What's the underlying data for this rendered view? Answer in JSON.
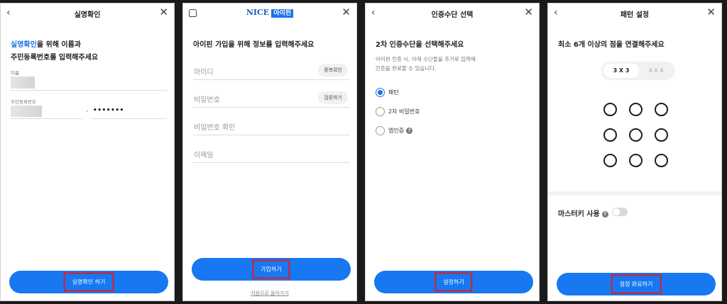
{
  "panel1": {
    "title": "실명확인",
    "back_icon": "chevron-left-icon",
    "close_icon": "close-icon",
    "heading_highlight": "실명확인",
    "heading_line1_rest": "을 위해 이름과",
    "heading_line2": "주민등록번호를 입력해주세요",
    "name_label": "이름",
    "rrn_label": "주민등록번호",
    "rrn_separator": "-",
    "rrn_back_masked": "•••••••",
    "submit_label": "실명확인 하기"
  },
  "panel2": {
    "brand_nice": "NICE",
    "brand_ipin": "아이핀",
    "home_icon": "home-icon",
    "close_icon": "close-icon",
    "heading": "아이핀 가입을 위해 정보를 입력해주세요",
    "fields": [
      {
        "placeholder": "아이디",
        "action": "중복확인"
      },
      {
        "placeholder": "비밀번호",
        "action": "검증하기"
      },
      {
        "placeholder": "비밀번호 확인",
        "action": ""
      },
      {
        "placeholder": "이메일",
        "action": ""
      }
    ],
    "submit_label": "가입하기",
    "back_link": "처음으로 돌아가기"
  },
  "panel3": {
    "title": "인증수단 선택",
    "back_icon": "chevron-left-icon",
    "close_icon": "close-icon",
    "heading": "2차 인증수단을 선택해주세요",
    "desc_line1": "아이핀 인증 시, 아래 수단들을 추가로 입력해",
    "desc_line2": "인증을 완료할 수 있습니다.",
    "options": [
      {
        "label": "패턴",
        "selected": true
      },
      {
        "label": "2차 비밀번호",
        "selected": false
      },
      {
        "label": "앱인증",
        "selected": false
      }
    ],
    "submit_label": "설정하기"
  },
  "panel4": {
    "title": "패턴 설정",
    "back_icon": "chevron-left-icon",
    "close_icon": "close-icon",
    "heading": "최소 6개 이상의 점을 연결해주세요",
    "grid_active": "3 X 3",
    "grid_inactive": "4 X 4",
    "master_key_label": "마스터키 사용",
    "master_key_on": false,
    "submit_label": "설정 완료하기"
  },
  "colors": {
    "accent": "#1778f2",
    "highlight_box": "#e01b24"
  }
}
